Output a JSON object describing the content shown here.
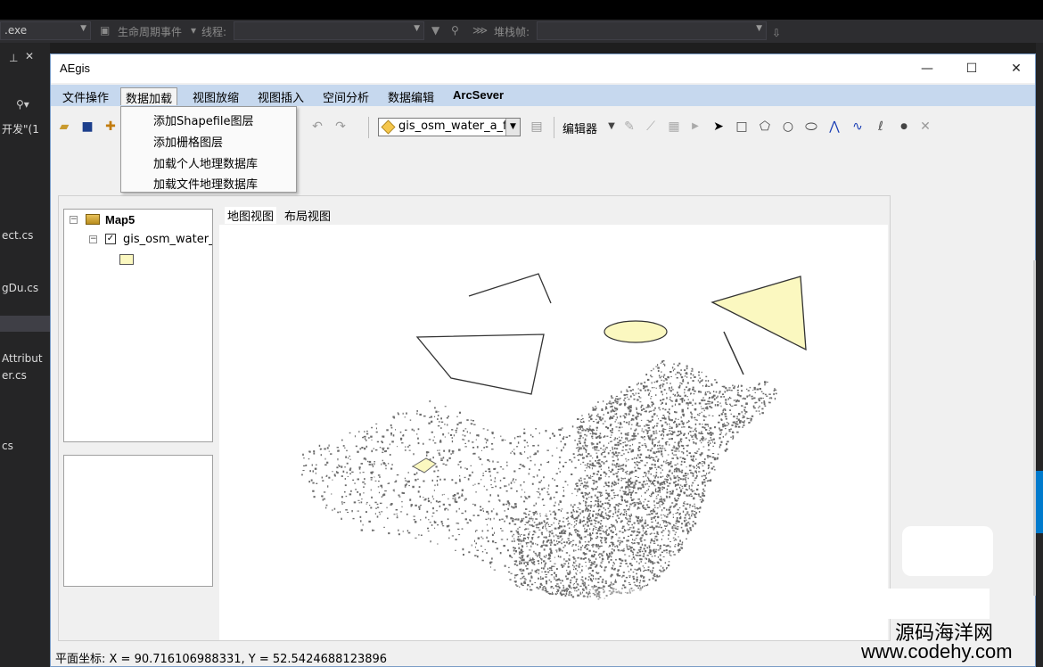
{
  "ide": {
    "process_fragment": ".exe",
    "lifecycle_label": "生命周期事件",
    "thread_label": "线程:",
    "stack_label": "堆栈帧:",
    "left_panel_texts": [
      "开发\"(1",
      "ect.cs",
      "gDu.cs",
      "Attribut",
      "er.cs",
      "cs"
    ]
  },
  "app": {
    "title": "AEgis",
    "window_controls": {
      "minimize": "—",
      "maximize": "☐",
      "close": "✕"
    }
  },
  "menu": {
    "items": [
      "文件操作",
      "数据加载",
      "视图放缩",
      "视图插入",
      "空间分析",
      "数据编辑",
      "ArcSever"
    ],
    "active": "数据加载",
    "dropdown": [
      "添加Shapefile图层",
      "添加栅格图层",
      "加载个人地理数据库",
      "加载文件地理数据库"
    ]
  },
  "toolbar": {
    "layer_combo_value": "gis_osm_water_a_fr",
    "editor_label": "编辑器"
  },
  "toc": {
    "map_name": "Map5",
    "layer_name": "gis_osm_water_a",
    "layer_checked": true,
    "expand_glyph": "⊟"
  },
  "tabs": [
    "地图视图",
    "布局视图"
  ],
  "map": {
    "symbol_fill": "#fbf8c0",
    "ink_color": "#6b6b6b",
    "outline_color": "#333333"
  },
  "status": {
    "text": "平面坐标: X = 90.716106988331, Y = 52.5424688123896"
  },
  "watermark": {
    "line1": "源码海洋网",
    "line2": "www.codehy.com"
  }
}
